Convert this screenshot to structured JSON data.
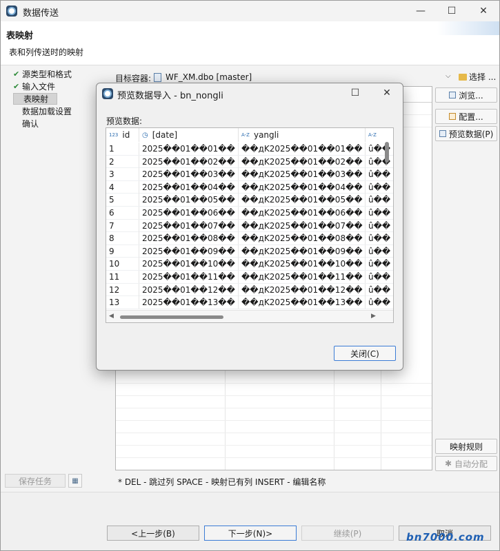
{
  "window": {
    "title": "数据传送",
    "header_title": "表映射",
    "header_subtitle": "表和列传送时的映射"
  },
  "nav": {
    "items": [
      {
        "label": "源类型和格式",
        "done": true
      },
      {
        "label": "输入文件",
        "done": true
      },
      {
        "label": "表映射",
        "done": false,
        "selected": true
      },
      {
        "label": "数据加载设置",
        "done": false
      },
      {
        "label": "确认",
        "done": false
      }
    ]
  },
  "target": {
    "label": "目标容器:",
    "value": "WF_XM.dbo  [master]",
    "choose_label": "选择 ..."
  },
  "right_buttons": {
    "browse": "浏览...",
    "config": "配置...",
    "preview": "预览数据(P)",
    "mapping_rules": "映射规则",
    "auto_assign": "自动分配"
  },
  "hint": "* DEL - 跳过列  SPACE - 映射已有列  INSERT - 编辑名称",
  "save_task": "保存任务",
  "bottom": {
    "back": "<上一步(B)",
    "next": "下一步(N)>",
    "continue": "继续(P)",
    "cancel": "取消"
  },
  "watermark": "bn7000.com",
  "dialog": {
    "title": "预览数据导入 - bn_nongli",
    "preview_label": "预览数据:",
    "close": "关闭(C)",
    "columns": [
      {
        "name": "id",
        "type_icon": "123"
      },
      {
        "name": "[date]",
        "type_icon": "clock"
      },
      {
        "name": "yangli",
        "type_icon": "A-Z"
      },
      {
        "name": "",
        "type_icon": "A-Z"
      }
    ],
    "rows": [
      [
        "1",
        "2025��01��01��",
        "��дK2025��01��01��",
        "û��"
      ],
      [
        "2",
        "2025��01��02��",
        "��дK2025��01��02��",
        "û��"
      ],
      [
        "3",
        "2025��01��03��",
        "��дK2025��01��03��",
        "û��"
      ],
      [
        "4",
        "2025��01��04��",
        "��дK2025��01��04��",
        "û��"
      ],
      [
        "5",
        "2025��01��05��",
        "��дK2025��01��05��",
        "û��"
      ],
      [
        "6",
        "2025��01��06��",
        "��дK2025��01��06��",
        "û��"
      ],
      [
        "7",
        "2025��01��07��",
        "��дK2025��01��07��",
        "û��"
      ],
      [
        "8",
        "2025��01��08��",
        "��дK2025��01��08��",
        "û��"
      ],
      [
        "9",
        "2025��01��09��",
        "��дK2025��01��09��",
        "û��"
      ],
      [
        "10",
        "2025��01��10��",
        "��дK2025��01��10��",
        "û��"
      ],
      [
        "11",
        "2025��01��11��",
        "��дK2025��01��11��",
        "û��"
      ],
      [
        "12",
        "2025��01��12��",
        "��дK2025��01��12��",
        "û��"
      ],
      [
        "13",
        "2025��01��13��",
        "��дK2025��01��13��",
        "û��"
      ]
    ]
  }
}
